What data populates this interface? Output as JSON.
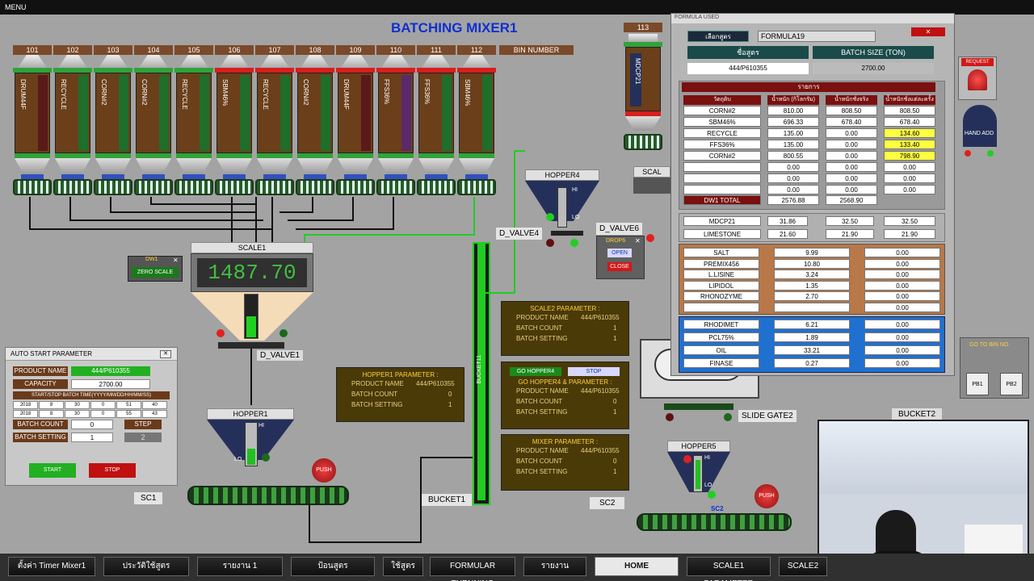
{
  "menu": "MENU",
  "title": "BATCHING MIXER1",
  "bin_number_label": "BIN NUMBER",
  "bins": [
    {
      "num": "101",
      "name": "DRUM44F",
      "cap": "green",
      "side": "maroon"
    },
    {
      "num": "102",
      "name": "RECYCLE",
      "cap": "green",
      "side": "green"
    },
    {
      "num": "103",
      "name": "CORN#2",
      "cap": "green",
      "side": "green"
    },
    {
      "num": "104",
      "name": "CORN#2",
      "cap": "green",
      "side": "green"
    },
    {
      "num": "105",
      "name": "RECYCLE",
      "cap": "green",
      "side": "green"
    },
    {
      "num": "106",
      "name": "SBM46%",
      "cap": "red",
      "side": "green"
    },
    {
      "num": "107",
      "name": "RECYCLE",
      "cap": "red",
      "side": "green"
    },
    {
      "num": "108",
      "name": "CORN#2",
      "cap": "red",
      "side": "green"
    },
    {
      "num": "109",
      "name": "DRUM44F",
      "cap": "red",
      "side": "maroon"
    },
    {
      "num": "110",
      "name": "FFS36%",
      "cap": "red",
      "side": "purple"
    },
    {
      "num": "111",
      "name": "FFS36%",
      "cap": "red",
      "side": "green"
    },
    {
      "num": "112",
      "name": "SBM46%",
      "cap": "red",
      "side": "green"
    }
  ],
  "bin113": {
    "num": "113",
    "name": "MDCP21"
  },
  "scale1": {
    "label": "SCALE1",
    "value": "1487.70",
    "dw1": "DW1",
    "zero": "ZERO SCALE",
    "valve": "D_VALVE1"
  },
  "hopper1": {
    "label": "HOPPER1",
    "hi": "HI",
    "lo": "LO",
    "push": "PUSH",
    "sc": "SC1",
    "bucket": "BUCKET1"
  },
  "hopper4": {
    "label": "HOPPER4",
    "hi": "HI",
    "lo": "LO",
    "valve": "D_VALVE4",
    "valve6": "D_VALVE6",
    "drop": "DROP6",
    "open": "OPEN",
    "close": "CLOSE",
    "scale": "SCAL"
  },
  "hopper5": {
    "label": "HOPPER5",
    "hi": "HI",
    "lo": "LO",
    "push": "PUSH",
    "sc": "SC2",
    "sc2tag": "SC2",
    "slide": "SLIDE GATE2",
    "bucket2": "BUCKET2"
  },
  "hopper1_param": {
    "title": "HOPPER1 PARAMETER :",
    "rows": [
      [
        "PRODUCT NAME",
        "444/P610355"
      ],
      [
        "BATCH COUNT",
        "0"
      ],
      [
        "BATCH SETTING",
        "1"
      ]
    ]
  },
  "scale2_param": {
    "title": "SCALE2 PARAMETER :",
    "rows": [
      [
        "PRODUCT NAME",
        "444/P610355"
      ],
      [
        "BATCH COUNT",
        "1"
      ],
      [
        "BATCH SETTING",
        "1"
      ]
    ]
  },
  "hopper4_param": {
    "go": "GO HOPPER4",
    "stop": "STOP",
    "title": "GO HOPPER4 & PARAMETER :",
    "rows": [
      [
        "PRODUCT NAME",
        "444/P610355"
      ],
      [
        "BATCH COUNT",
        "0"
      ],
      [
        "BATCH SETTING",
        "1"
      ]
    ]
  },
  "mixer_param": {
    "title": "MIXER PARAMETER :",
    "rows": [
      [
        "PRODUCT NAME",
        "444/P610355"
      ],
      [
        "BATCH COUNT",
        "0"
      ],
      [
        "BATCH SETTING",
        "1"
      ]
    ]
  },
  "bucket11": "BUCKET11",
  "auto": {
    "title": "AUTO START PARAMETER",
    "product_label": "PRODUCT NAME",
    "product": "444/P610355",
    "capacity_label": "CAPACITY",
    "capacity": "2700.00",
    "time_label": "START/STOP BATCH TIME(YYYY/MM/DD/HH/MM/SS)",
    "time_rows": [
      [
        "2018",
        "8",
        "30",
        "0",
        "51",
        "40"
      ],
      [
        "2018",
        "8",
        "30",
        "0",
        "55",
        "43"
      ]
    ],
    "count_label": "BATCH COUNT",
    "count": "0",
    "step_label": "STEP",
    "setting_label": "BATCH SETTING",
    "setting": "1",
    "step": "2",
    "start": "START",
    "stop": "STOP"
  },
  "formula": {
    "window_title": "FORMULA USED",
    "select_label": "เลือกสูตร",
    "formula_name": "FORMULA19",
    "name_label": "ชื่อสูตร",
    "batch_size_label": "BATCH SIZE (TON)",
    "product": "444/P610355",
    "batch_size": "2700.00",
    "list_title": "รายการ",
    "cols": [
      "วัตถุดิบ",
      "น้ำหนัก (กิโลกรัม)",
      "น้ำหนักชั่งจริง",
      "น้ำหนักชั่งแต่ละครั้ง"
    ],
    "rows": [
      [
        "CORN#2",
        "810.00",
        "808.50",
        "808.50"
      ],
      [
        "SBM46%",
        "696.33",
        "678.40",
        "678.40"
      ],
      [
        "RECYCLE",
        "135.00",
        "0.00",
        "134.60"
      ],
      [
        "FFS36%",
        "135.00",
        "0.00",
        "133.40"
      ],
      [
        "CORN#2",
        "800.55",
        "0.00",
        "798.90"
      ],
      [
        "",
        "0.00",
        "0.00",
        "0.00"
      ],
      [
        "",
        "0.00",
        "0.00",
        "0.00"
      ],
      [
        "",
        "0.00",
        "0.00",
        "0.00"
      ]
    ],
    "total": [
      "DW1 TOTAL",
      "2576.88",
      "2568.90",
      ""
    ],
    "group2": [
      [
        "MDCP21",
        "31.86",
        "32.50",
        "32.50"
      ],
      [
        "LIMESTONE",
        "21.60",
        "21.90",
        "21.90"
      ]
    ],
    "group3": [
      [
        "SALT",
        "9.99",
        "0.00"
      ],
      [
        "PREMIX456",
        "10.80",
        "0.00"
      ],
      [
        "L.LISINE",
        "3.24",
        "0.00"
      ],
      [
        "LIPIDOL",
        "1.35",
        "0.00"
      ],
      [
        "RHONOZYME",
        "2.70",
        "0.00"
      ],
      [
        "",
        "",
        "0.00"
      ]
    ],
    "group4": [
      [
        "RHODIMET",
        "6.21",
        "0.00"
      ],
      [
        "PCL75%",
        "1.89",
        "0.00"
      ],
      [
        "OIL",
        "33.21",
        "0.00"
      ],
      [
        "FINASE",
        "0.27",
        "0.00"
      ]
    ]
  },
  "right": {
    "request": "REQUEST",
    "hand_add": "HAND ADD",
    "go_bin": "GO TO BIN NO.",
    "pb1": "PB1",
    "pb2": "PB2"
  },
  "bottom": [
    "ตั้งค่า Timer Mixer1",
    "ประวัติใช้สูตร",
    "รายงาน 1",
    "ป้อนสูตร",
    "ใช้สูตร",
    "FORMULAR TURNNING",
    "รายงาน",
    "HOME",
    "SCALE1 PARAMETER",
    "SCALE2"
  ]
}
